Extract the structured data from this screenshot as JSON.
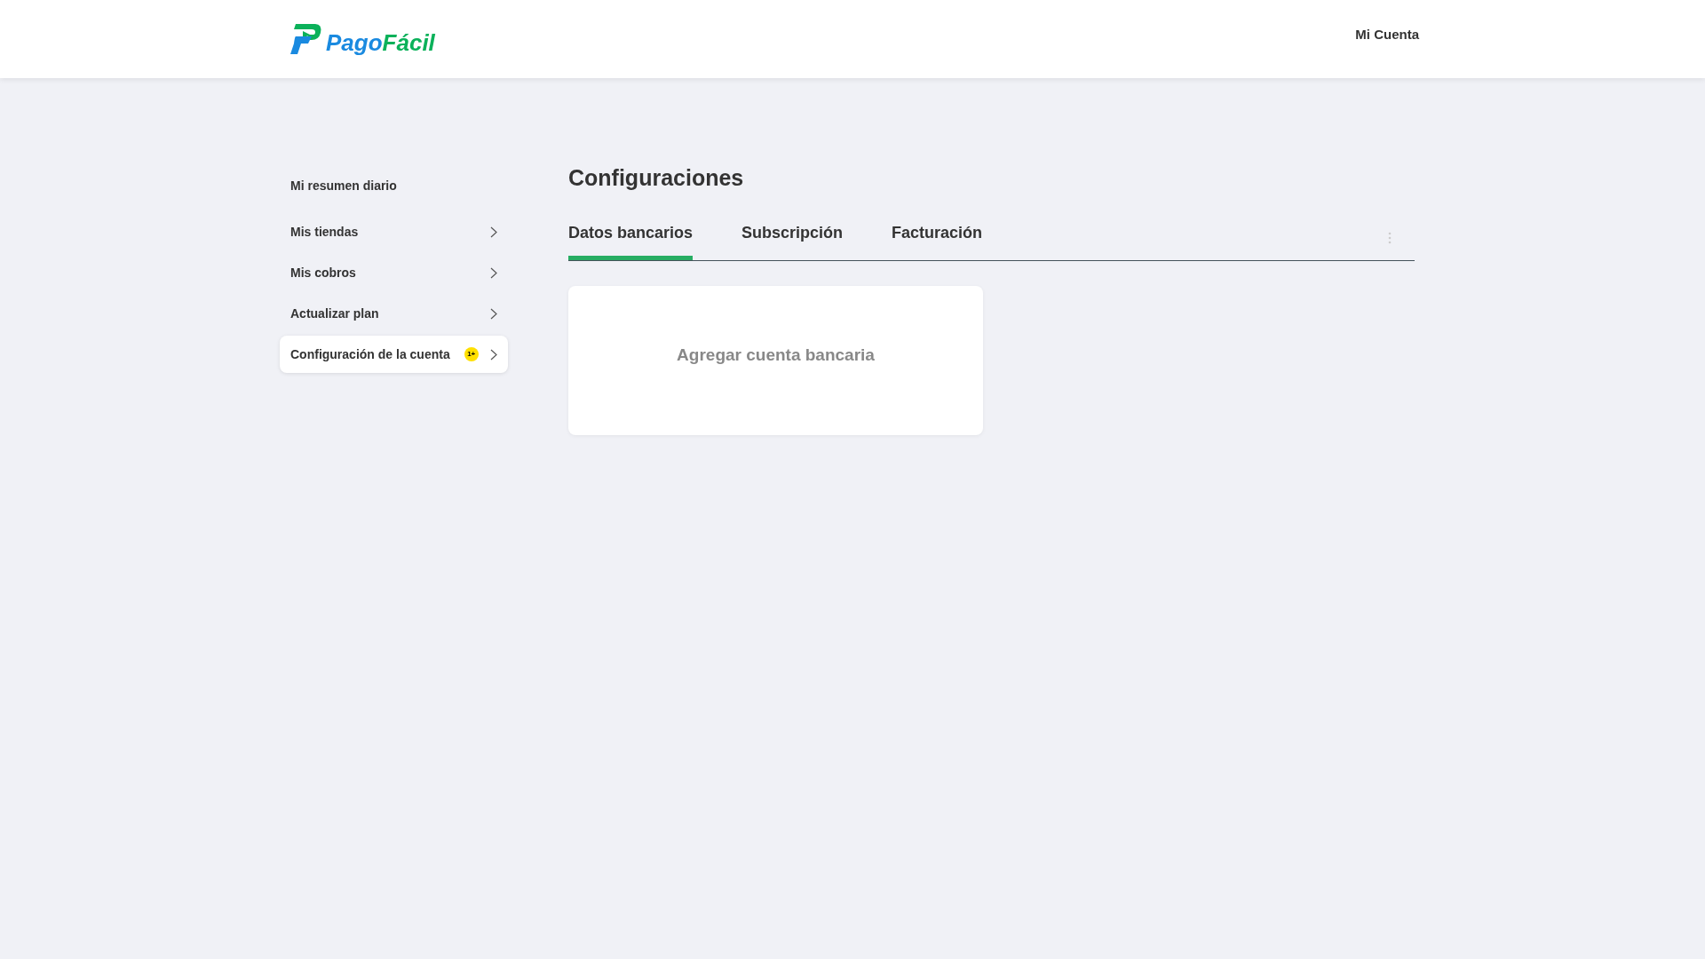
{
  "header": {
    "logo": {
      "part_1": "Pago",
      "part_2": "Fácil"
    },
    "account_link": "Mi Cuenta"
  },
  "sidebar": {
    "items": [
      {
        "label": "Mi resumen diario",
        "has_arrow": false,
        "selected": false
      },
      {
        "label": "Mis tiendas",
        "has_arrow": true,
        "selected": false
      },
      {
        "label": "Mis cobros",
        "has_arrow": true,
        "selected": false
      },
      {
        "label": "Actualizar plan",
        "has_arrow": true,
        "selected": false
      },
      {
        "label": "Configuración de la cuenta",
        "has_arrow": true,
        "selected": true,
        "badge": "1+"
      }
    ]
  },
  "main": {
    "title": "Configuraciones",
    "tabs": [
      {
        "label": "Datos bancarios",
        "selected": true
      },
      {
        "label": "Subscripción",
        "selected": false
      },
      {
        "label": "Facturación",
        "selected": false
      }
    ],
    "card": {
      "action": "Agregar cuenta bancaria"
    }
  }
}
